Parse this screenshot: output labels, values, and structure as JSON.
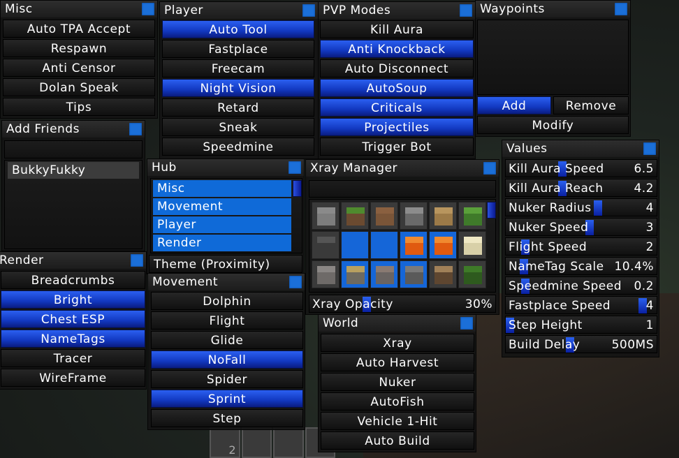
{
  "colors": {
    "accent": "#1b6fd8",
    "active_button": "#1a48d8",
    "panel": "#141414"
  },
  "misc": {
    "title": "Misc",
    "items": [
      {
        "label": "Auto TPA Accept",
        "active": false
      },
      {
        "label": "Respawn",
        "active": false
      },
      {
        "label": "Anti Censor",
        "active": false
      },
      {
        "label": "Dolan Speak",
        "active": false
      },
      {
        "label": "Tips",
        "active": false
      }
    ]
  },
  "player": {
    "title": "Player",
    "items": [
      {
        "label": "Auto Tool",
        "active": true
      },
      {
        "label": "Fastplace",
        "active": false
      },
      {
        "label": "Freecam",
        "active": false
      },
      {
        "label": "Night Vision",
        "active": true
      },
      {
        "label": "Retard",
        "active": false
      },
      {
        "label": "Sneak",
        "active": false
      },
      {
        "label": "Speedmine",
        "active": false
      }
    ]
  },
  "pvp": {
    "title": "PVP Modes",
    "items": [
      {
        "label": "Kill Aura",
        "active": false
      },
      {
        "label": "Anti Knockback",
        "active": true
      },
      {
        "label": "Auto Disconnect",
        "active": false
      },
      {
        "label": "AutoSoup",
        "active": true
      },
      {
        "label": "Criticals",
        "active": true
      },
      {
        "label": "Projectiles",
        "active": true
      },
      {
        "label": "Trigger Bot",
        "active": false
      }
    ]
  },
  "waypoints": {
    "title": "Waypoints",
    "add": "Add",
    "remove": "Remove",
    "modify": "Modify"
  },
  "friends": {
    "title": "Add Friends",
    "input_value": "",
    "list": [
      "BukkyFukky"
    ]
  },
  "hub": {
    "title": "Hub",
    "items": [
      "Misc",
      "Movement",
      "Player",
      "Render"
    ],
    "theme": "Theme (Proximity)"
  },
  "render": {
    "title": "Render",
    "items": [
      {
        "label": "Breadcrumbs",
        "active": false
      },
      {
        "label": "Bright",
        "active": true
      },
      {
        "label": "Chest ESP",
        "active": true
      },
      {
        "label": "NameTags",
        "active": true
      },
      {
        "label": "Tracer",
        "active": false
      },
      {
        "label": "WireFrame",
        "active": false
      }
    ]
  },
  "movement": {
    "title": "Movement",
    "items": [
      {
        "label": "Dolphin",
        "active": false
      },
      {
        "label": "Flight",
        "active": false
      },
      {
        "label": "Glide",
        "active": false
      },
      {
        "label": "NoFall",
        "active": true
      },
      {
        "label": "Spider",
        "active": false
      },
      {
        "label": "Sprint",
        "active": true
      },
      {
        "label": "Step",
        "active": false
      }
    ]
  },
  "xray": {
    "title": "Xray Manager",
    "search_value": "",
    "blocks": [
      {
        "icon": "stone-block-icon",
        "color": "#7d7d7d",
        "top": "#8a8a8a",
        "selected": false
      },
      {
        "icon": "grass-block-icon",
        "color": "#6b4a30",
        "top": "#4f8a2e",
        "selected": false
      },
      {
        "icon": "dirt-block-icon",
        "color": "#7a5538",
        "top": "#8a6040",
        "selected": false
      },
      {
        "icon": "cobblestone-block-icon",
        "color": "#6a6a6a",
        "top": "#8c8c8c",
        "selected": false
      },
      {
        "icon": "planks-block-icon",
        "color": "#9c7a48",
        "top": "#b8955e",
        "selected": false
      },
      {
        "icon": "leaves-block-icon",
        "color": "#3f7a2a",
        "top": "#5aa03a",
        "selected": false
      },
      {
        "icon": "bedrock-block-icon",
        "color": "#3a3a3a",
        "top": "#555555",
        "selected": false
      },
      {
        "icon": "water-block-icon",
        "color": "#1a50e0",
        "top": "#2a60f0",
        "selected": true
      },
      {
        "icon": "water-block-icon",
        "color": "#1a50e0",
        "top": "#2a60f0",
        "selected": true
      },
      {
        "icon": "lava-block-icon",
        "color": "#e05a10",
        "top": "#f08a30",
        "selected": true
      },
      {
        "icon": "lava-block-icon",
        "color": "#e05a10",
        "top": "#f08a30",
        "selected": true
      },
      {
        "icon": "sandstone-block-icon",
        "color": "#d8d0a8",
        "top": "#efe8c4",
        "selected": false
      },
      {
        "icon": "gravel-block-icon",
        "color": "#6e6a68",
        "top": "#8a8684",
        "selected": false
      },
      {
        "icon": "gold-ore-block-icon",
        "color": "#6e6a60",
        "top": "#b8a060",
        "selected": true
      },
      {
        "icon": "iron-ore-block-icon",
        "color": "#6a6462",
        "top": "#8a7a72",
        "selected": true
      },
      {
        "icon": "coal-ore-block-icon",
        "color": "#5a5a5a",
        "top": "#7a7a7a",
        "selected": true
      },
      {
        "icon": "log-block-icon",
        "color": "#5e4630",
        "top": "#a08058",
        "selected": false
      },
      {
        "icon": "mossy-block-icon",
        "color": "#2e5a1e",
        "top": "#3e7a28",
        "selected": false
      }
    ],
    "opacity_label": "Xray Opacity",
    "opacity_value": "30%",
    "opacity_slider": 0.3
  },
  "world": {
    "title": "World",
    "items": [
      {
        "label": "Xray",
        "active": false
      },
      {
        "label": "Auto Harvest",
        "active": false
      },
      {
        "label": "Nuker",
        "active": false
      },
      {
        "label": "AutoFish",
        "active": false
      },
      {
        "label": "Vehicle 1-Hit",
        "active": false
      },
      {
        "label": "Auto Build",
        "active": false
      }
    ]
  },
  "values": {
    "title": "Values",
    "rows": [
      {
        "label": "Kill Aura Speed",
        "value": "6.5",
        "slider": 0.37
      },
      {
        "label": "Kill Aura Reach",
        "value": "4.2",
        "slider": 0.37
      },
      {
        "label": "Nuker Radius",
        "value": "4",
        "slider": 0.62
      },
      {
        "label": "Nuker Speed",
        "value": "3",
        "slider": 0.56
      },
      {
        "label": "Flight Speed",
        "value": "2",
        "slider": 0.11
      },
      {
        "label": "NameTag Scale",
        "value": "10.4%",
        "slider": 0.1
      },
      {
        "label": "Speedmine Speed",
        "value": "0.2",
        "slider": 0.11
      },
      {
        "label": "Fastplace Speed",
        "value": "4",
        "slider": 0.93
      },
      {
        "label": "Step Height",
        "value": "1",
        "slider": 0.0
      },
      {
        "label": "Build Delay",
        "value": "500MS",
        "slider": 0.42
      }
    ]
  },
  "hotbar": {
    "slot_count": "2"
  }
}
